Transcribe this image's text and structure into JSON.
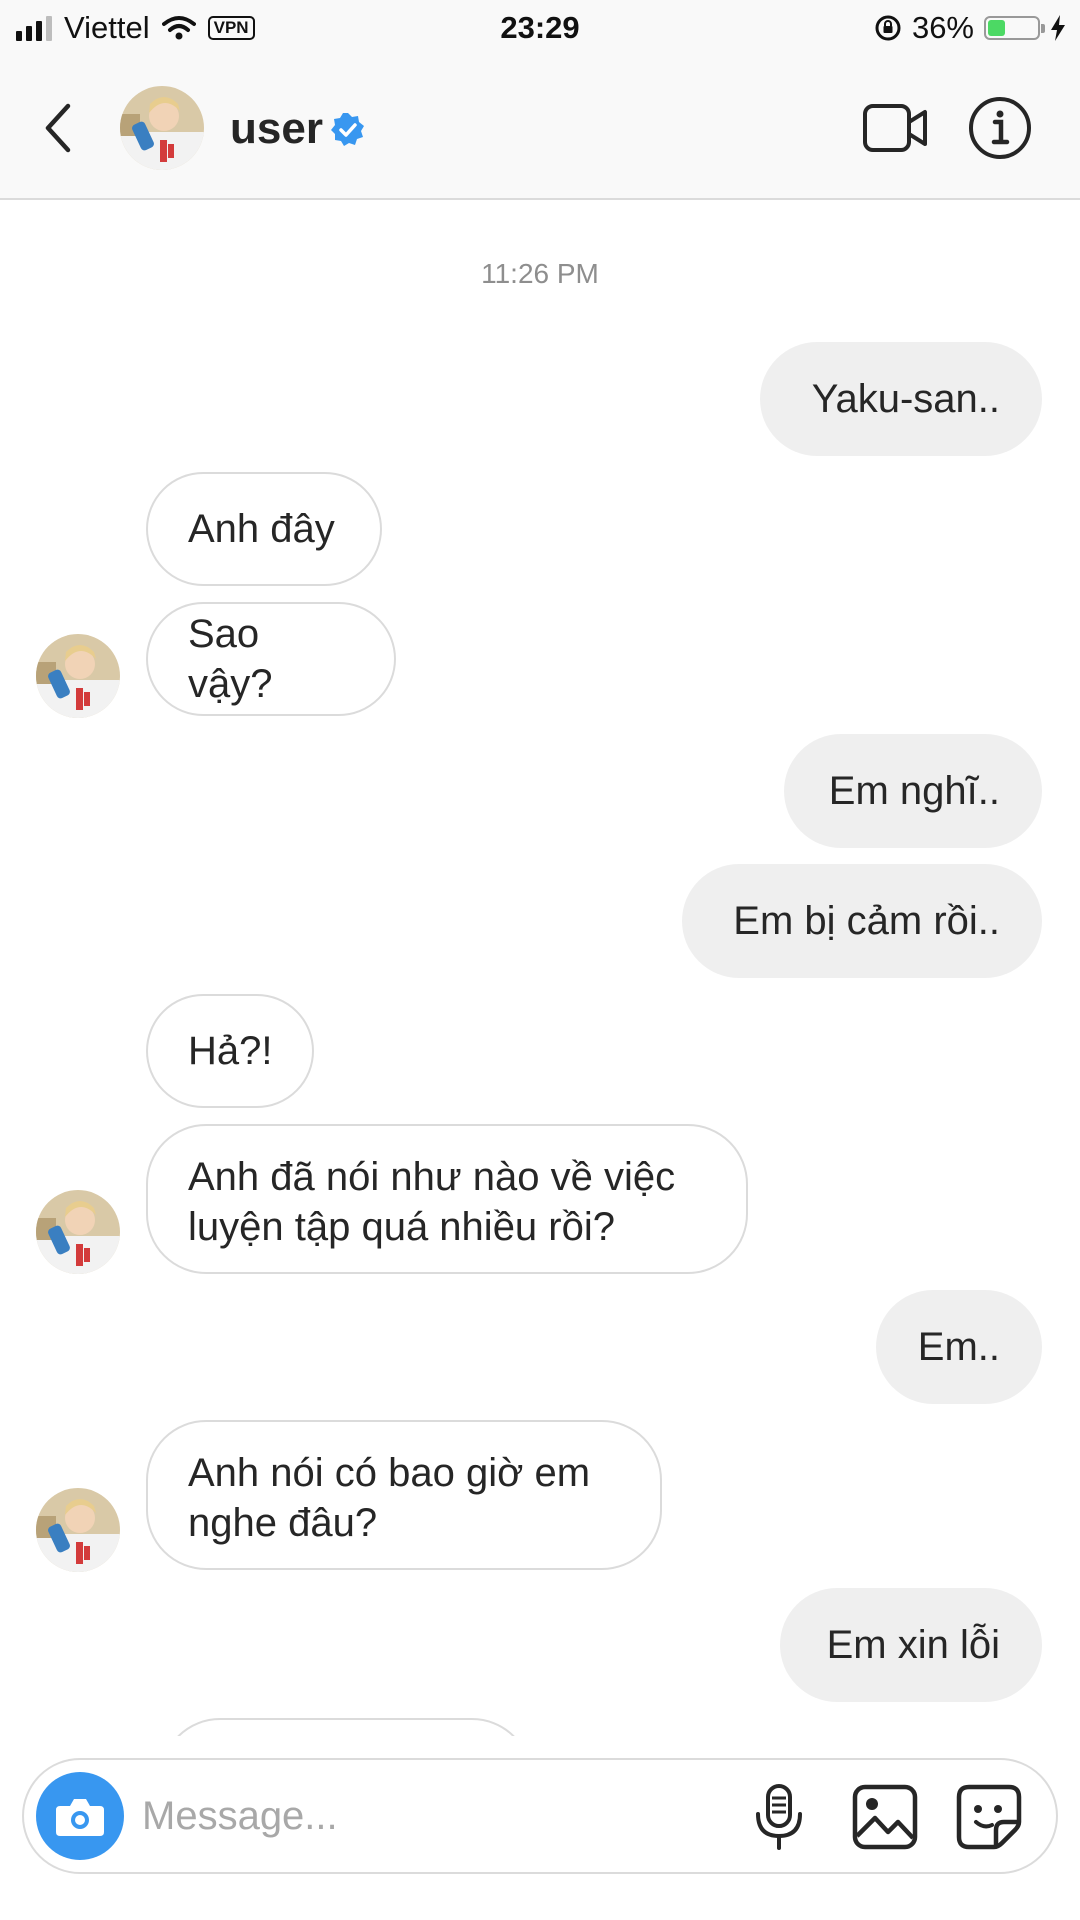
{
  "status_bar": {
    "carrier": "Viettel",
    "vpn": "VPN",
    "time": "23:29",
    "battery_percent": "36%",
    "battery_level": 0.36,
    "signal_bars": 3,
    "icons": [
      "signal-icon",
      "wifi-icon",
      "orientation-lock-icon",
      "battery-icon",
      "charging-icon"
    ]
  },
  "header": {
    "username": "user",
    "verified": true,
    "icons": [
      "back-chevron-icon",
      "verified-badge-icon",
      "video-call-icon",
      "info-icon"
    ]
  },
  "chat": {
    "timestamp": "11:26 PM",
    "messages": [
      {
        "from": "me",
        "text": "Yaku-san.."
      },
      {
        "from": "them",
        "text": "Anh đây"
      },
      {
        "from": "them",
        "text": "Sao vậy?"
      },
      {
        "from": "me",
        "text": "Em nghĩ.."
      },
      {
        "from": "me",
        "text": "Em bị cảm rồi.."
      },
      {
        "from": "them",
        "text": "Hả?!"
      },
      {
        "from": "them",
        "text_lines": [
          "Anh đã nói như nào về việc",
          "luyện tập quá nhiều rồi?"
        ]
      },
      {
        "from": "me",
        "text": "Em.."
      },
      {
        "from": "them",
        "text_lines": [
          "Anh nói có bao giờ em",
          "nghe đâu?"
        ]
      },
      {
        "from": "me",
        "text": "Em xin lỗi"
      }
    ]
  },
  "composer": {
    "placeholder": "Message...",
    "value": "",
    "icons": [
      "camera-icon",
      "microphone-icon",
      "gallery-icon",
      "sticker-icon"
    ]
  },
  "colors": {
    "accent": "#3897f0",
    "outgoing_bubble": "#efefef",
    "border": "#dbdbdb",
    "muted_text": "#8e8e8e",
    "battery_green": "#4cd964"
  }
}
